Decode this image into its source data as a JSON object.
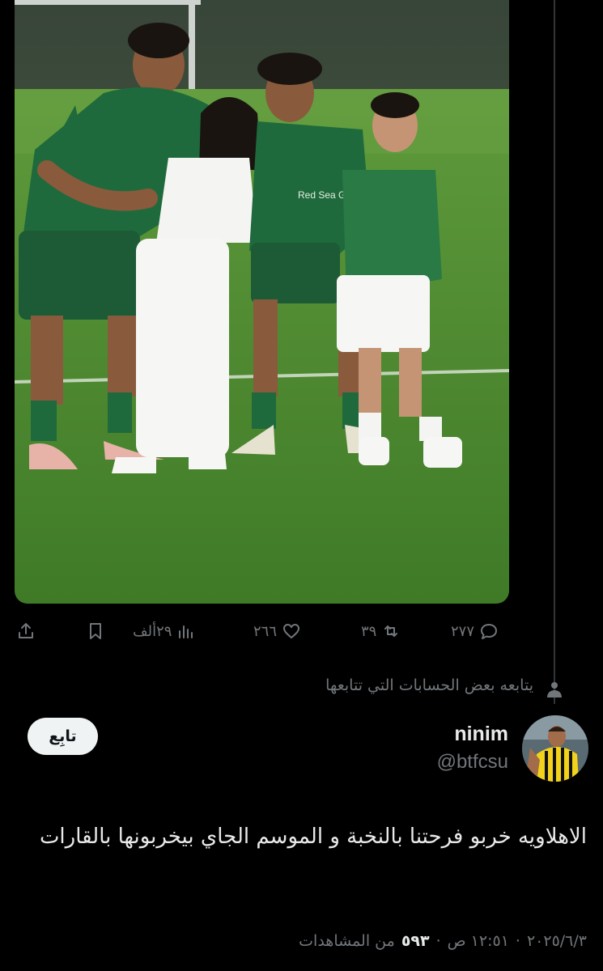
{
  "tweet_media": {
    "image_alt_icon": "photo-of-four-kids-on-football-pitch",
    "jersey_text": "Red Sea Global"
  },
  "actions": {
    "reply_count": "٢٧٧",
    "retweet_count": "٣٩",
    "like_count": "٢٦٦",
    "views_count": "٢٩ألف"
  },
  "social_context": {
    "text": "يتابعه بعض الحسابات التي تتابعها",
    "icon": "person-icon"
  },
  "author": {
    "display_name": "ninim",
    "handle": "@btfcsu",
    "follow_label": "تابِع"
  },
  "tweet": {
    "text": "الاهلاويه خربو فرحتنا بالنخبة و الموسم الجاي بيخربونها بالقارات"
  },
  "meta": {
    "date": "٢٠٢٥/٦/٣",
    "time": "١٢:٥١ ص",
    "views_number": "٥٩٣",
    "views_label": "من المشاهدات",
    "separator": "·"
  },
  "colors": {
    "background": "#000000",
    "muted": "#71767b",
    "text": "#e7e9ea",
    "follow_button_bg": "#eff3f4"
  }
}
